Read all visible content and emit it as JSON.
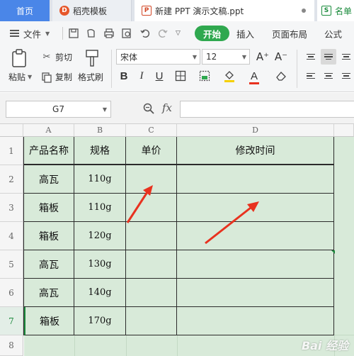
{
  "tabs": {
    "home": "首页",
    "tab1": "稻壳模板",
    "tab2": "新建 PPT 演示文稿.ppt",
    "tab3": "名单"
  },
  "menu": {
    "file": "文件",
    "start": "开始",
    "insert": "插入",
    "page_layout": "页面布局",
    "formula": "公式"
  },
  "ribbon": {
    "paste": "粘贴",
    "cut": "剪切",
    "copy": "复制",
    "format_painter": "格式刷",
    "font_name": "宋体",
    "font_size": "12",
    "bold": "B",
    "italic": "I",
    "underline": "U",
    "grow": "A⁺",
    "shrink": "A⁻",
    "font_color": "A"
  },
  "formula_bar": {
    "name_box": "G7",
    "fx": "fx",
    "value": ""
  },
  "columns": [
    "A",
    "B",
    "C",
    "D"
  ],
  "rows": [
    "1",
    "2",
    "3",
    "4",
    "5",
    "6",
    "7",
    "8"
  ],
  "table": {
    "headers": [
      "产品名称",
      "规格",
      "单价",
      "修改时间"
    ],
    "rows": [
      [
        "高瓦",
        "110g",
        "",
        ""
      ],
      [
        "箱板",
        "110g",
        "",
        ""
      ],
      [
        "箱板",
        "120g",
        "",
        ""
      ],
      [
        "高瓦",
        "130g",
        "",
        ""
      ],
      [
        "高瓦",
        "140g",
        "",
        ""
      ],
      [
        "箱板",
        "170g",
        "",
        ""
      ]
    ]
  },
  "colors": {
    "accent_green": "#2fa84f",
    "cell_fill": "#d8ead9",
    "arrow_red": "#e8321f",
    "home_tab": "#4a86e8"
  },
  "watermark": "Bai 经验"
}
